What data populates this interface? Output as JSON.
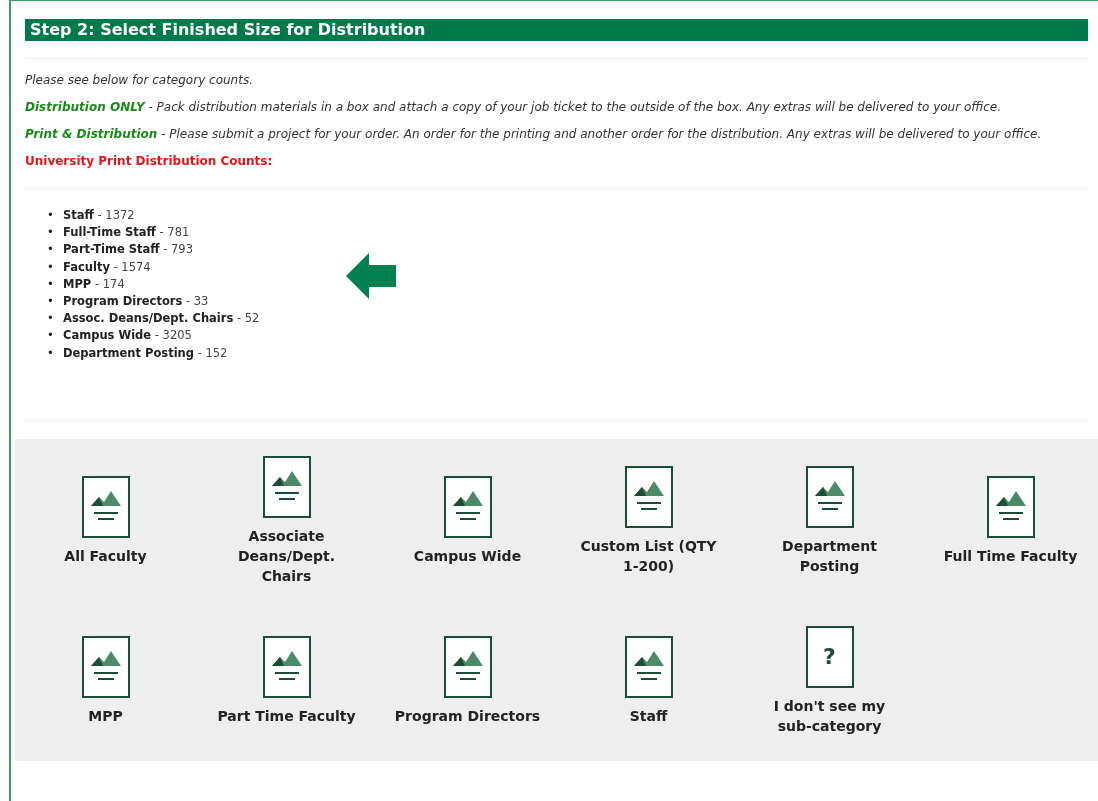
{
  "header": {
    "title": "Step 2: Select Finished Size for Distribution"
  },
  "intro": "Please see below for category counts.",
  "notes": [
    {
      "term": "Distribution ONLY",
      "text": " - Pack distribution materials in a box and attach a copy of your job ticket to the outside of the box. Any extras will be delivered to your office."
    },
    {
      "term": "Print & Distribution",
      "text": " - Please submit a project for your order. An order for the printing and another order for the distribution. Any extras will be delivered to your office."
    }
  ],
  "counts_heading": "University Print Distribution Counts:",
  "bullet": "•",
  "counts": [
    {
      "name": "Staff",
      "count": " - 1372"
    },
    {
      "name": "Full-Time Staff",
      "count": " - 781"
    },
    {
      "name": "Part-Time Staff",
      "count": " - 793"
    },
    {
      "name": "Faculty",
      "count": " - 1574"
    },
    {
      "name": "MPP",
      "count": " - 174"
    },
    {
      "name": "Program Directors",
      "count": " - 33"
    },
    {
      "name": "Assoc. Deans/Dept. Chairs",
      "count": " - 52"
    },
    {
      "name": "Campus Wide",
      "count": " - 3205"
    },
    {
      "name": "Department Posting",
      "count": " - 152"
    }
  ],
  "options": [
    {
      "kind": "size",
      "label": "All Faculty"
    },
    {
      "kind": "size",
      "label": "Associate Deans/Dept. Chairs"
    },
    {
      "kind": "size",
      "label": "Campus Wide"
    },
    {
      "kind": "size",
      "label": "Custom List (QTY 1-200)"
    },
    {
      "kind": "size",
      "label": "Department Posting"
    },
    {
      "kind": "size",
      "label": "Full Time Faculty"
    },
    {
      "kind": "size",
      "label": "MPP"
    },
    {
      "kind": "size",
      "label": "Part Time Faculty"
    },
    {
      "kind": "size",
      "label": "Program Directors"
    },
    {
      "kind": "size",
      "label": "Staff"
    },
    {
      "kind": "question",
      "symbol": "?",
      "label": "I don't see my sub-category"
    }
  ]
}
